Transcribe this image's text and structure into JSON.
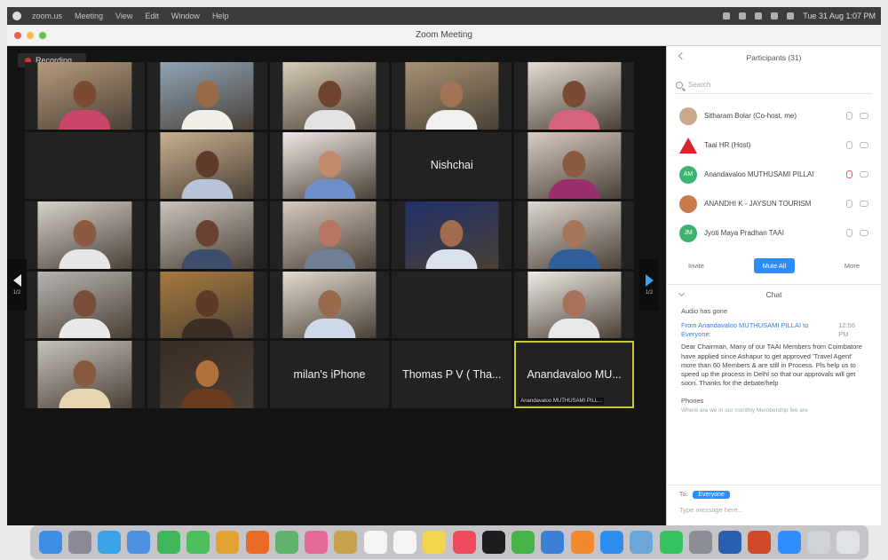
{
  "menubar": {
    "items": [
      "zoom.us",
      "Meeting",
      "View",
      "Edit",
      "Window",
      "Help"
    ],
    "clock": "Tue 31 Aug 1:07 PM"
  },
  "window": {
    "title": "Zoom Meeting"
  },
  "recording": {
    "label": "Recording..."
  },
  "grid": {
    "tiles": [
      {
        "type": "video",
        "bg": "#b79a7c",
        "skin": "#7b4a33",
        "shirt": "#c9456a"
      },
      {
        "type": "video",
        "bg": "#8fa5b8",
        "skin": "#9a6a48",
        "shirt": "#f2efe9"
      },
      {
        "type": "video",
        "bg": "#d9cdb8",
        "skin": "#6e4430",
        "shirt": "#e3e3e6"
      },
      {
        "type": "video",
        "bg": "#a89274",
        "skin": "#a17456",
        "shirt": "#f0f0f0"
      },
      {
        "type": "video",
        "bg": "#e4dcd2",
        "skin": "#7a4a34",
        "shirt": "#d5637e"
      },
      {
        "type": "empty"
      },
      {
        "type": "video",
        "bg": "#c9b08e",
        "skin": "#5e3b2a",
        "shirt": "#b7c3d9"
      },
      {
        "type": "video",
        "bg": "#f1e8e6",
        "skin": "#c08a6b",
        "shirt": "#6e8ec9"
      },
      {
        "type": "name",
        "name": "Nishchai"
      },
      {
        "type": "video",
        "bg": "#d8ccc4",
        "skin": "#8b5a40",
        "shirt": "#9a2f6e"
      },
      {
        "type": "video",
        "bg": "#d6d1cc",
        "skin": "#8b5a40",
        "shirt": "#e6e6e6"
      },
      {
        "type": "video",
        "bg": "#c9c4bc",
        "skin": "#6a4231",
        "shirt": "#3c4e6b"
      },
      {
        "type": "video",
        "bg": "#d6c9be",
        "skin": "#b57762",
        "shirt": "#6f7f96"
      },
      {
        "type": "video",
        "bg": "#20306a",
        "skin": "#a36c4f",
        "shirt": "#dbe1ee"
      },
      {
        "type": "video",
        "bg": "#ddd8d2",
        "skin": "#a6765a",
        "shirt": "#2e5e9c"
      },
      {
        "type": "video",
        "bg": "#b7b4b1",
        "skin": "#7a4d38",
        "shirt": "#e8e8e8"
      },
      {
        "type": "video",
        "bg": "#a87a3c",
        "skin": "#5d3a28",
        "shirt": "#3a2e26"
      },
      {
        "type": "video",
        "bg": "#e2dcd3",
        "skin": "#9a6a4d",
        "shirt": "#cfd9ea"
      },
      {
        "type": "empty"
      },
      {
        "type": "video",
        "bg": "#efebe6",
        "skin": "#a7735a",
        "shirt": "#e9e9e9"
      },
      {
        "type": "video",
        "bg": "#c6c2bc",
        "skin": "#8a5a40",
        "shirt": "#e7d6b0"
      },
      {
        "type": "video",
        "bg": "#3a2c24",
        "skin": "#b0703c",
        "shirt": "#6a3b1e"
      },
      {
        "type": "name",
        "name": "milan's iPhone"
      },
      {
        "type": "name",
        "name": "Thomas P V ( Tha..."
      },
      {
        "type": "name",
        "name": "Anandavaloo MU...",
        "caption": "Anandavaloo MUTHUSAMI PILL...",
        "active": true
      }
    ]
  },
  "nav": {
    "left_page": "1/2",
    "right_page": "1/2"
  },
  "participants": {
    "title": "Participants (31)",
    "search_placeholder": "Search",
    "list": [
      {
        "name": "Sitharam Bolar (Co-host, me)",
        "avatar": "#c9a98a",
        "avatar_type": "photo",
        "mic_muted": false
      },
      {
        "name": "Taai HR (Host)",
        "avatar": "#d8262e",
        "avatar_type": "triangle",
        "mic_muted": false
      },
      {
        "name": "Anandavaloo MUTHUSAMI PILLAI",
        "avatar": "#3cb371",
        "avatar_type": "initials",
        "initials": "AM",
        "mic_muted": true
      },
      {
        "name": "ANANDHI K - JAYSUN TOURISM",
        "avatar": "#c97a4a",
        "avatar_type": "photo",
        "mic_muted": false
      },
      {
        "name": "Jyoti Maya Pradhan TAAI",
        "avatar": "#3cb371",
        "avatar_type": "initials",
        "initials": "JM",
        "mic_muted": false
      }
    ],
    "btn_invite": "Invite",
    "btn_mute_all": "Mute All",
    "btn_more": "More"
  },
  "chat": {
    "title": "Chat",
    "system_line": "Audio has gone",
    "from": "From Anandavaloo MUTHUSAMI PILLAI to Everyone:",
    "time": "12:56 PM",
    "message": "Dear Chairman, Many of our TAAI Members from Coimbatore have applied since Ashapur to get approved 'Travel Agent' more than 60 Members & are still in Process. Pls help us to speed up the process in DelhI so that our approvals will get soon. Thanks for the debate/help",
    "second_label": "Phones",
    "second_msg": "Where are we in our monthly Membership fee are",
    "to_label": "To:",
    "to_value": "Everyone",
    "input_placeholder": "Type message here..."
  },
  "dock": {
    "apps": [
      {
        "name": "finder-icon",
        "color": "#3d8fe6"
      },
      {
        "name": "launchpad-icon",
        "color": "#8a8a96"
      },
      {
        "name": "safari-icon",
        "color": "#3aa3e8"
      },
      {
        "name": "mail-icon",
        "color": "#4b8fe0"
      },
      {
        "name": "facetime-icon",
        "color": "#3fb65a"
      },
      {
        "name": "messages-icon",
        "color": "#4cc05a"
      },
      {
        "name": "chrome-icon",
        "color": "#e2a232"
      },
      {
        "name": "firefox-icon",
        "color": "#e96a24"
      },
      {
        "name": "maps-icon",
        "color": "#5fb36a"
      },
      {
        "name": "photos-icon",
        "color": "#e7699a"
      },
      {
        "name": "notes-icon",
        "color": "#c9a34b"
      },
      {
        "name": "calendar-icon",
        "color": "#f4f4f4"
      },
      {
        "name": "reminders-icon",
        "color": "#f5f5f5"
      },
      {
        "name": "stickies-icon",
        "color": "#f2d44d"
      },
      {
        "name": "music-icon",
        "color": "#f04a5e"
      },
      {
        "name": "tv-icon",
        "color": "#1e1e1e"
      },
      {
        "name": "numbers-icon",
        "color": "#47b449"
      },
      {
        "name": "keynote-icon",
        "color": "#3c7fd6"
      },
      {
        "name": "pages-icon",
        "color": "#f08a2c"
      },
      {
        "name": "appstore-icon",
        "color": "#2f8df0"
      },
      {
        "name": "preview-icon",
        "color": "#6aa6d8"
      },
      {
        "name": "whatsapp-icon",
        "color": "#35c360"
      },
      {
        "name": "settings-icon",
        "color": "#8a8f96"
      },
      {
        "name": "word-icon",
        "color": "#2a5fb0"
      },
      {
        "name": "powerpoint-icon",
        "color": "#d04a2a"
      },
      {
        "name": "zoom-icon",
        "color": "#2d8cff"
      },
      {
        "name": "folder-icon",
        "color": "#cfd3d8"
      },
      {
        "name": "trash-icon",
        "color": "#dfe3e6"
      }
    ]
  },
  "colors": {
    "accent": "#2d8cff",
    "active_speaker": "#c9c83a",
    "video_bg": "#141414"
  }
}
